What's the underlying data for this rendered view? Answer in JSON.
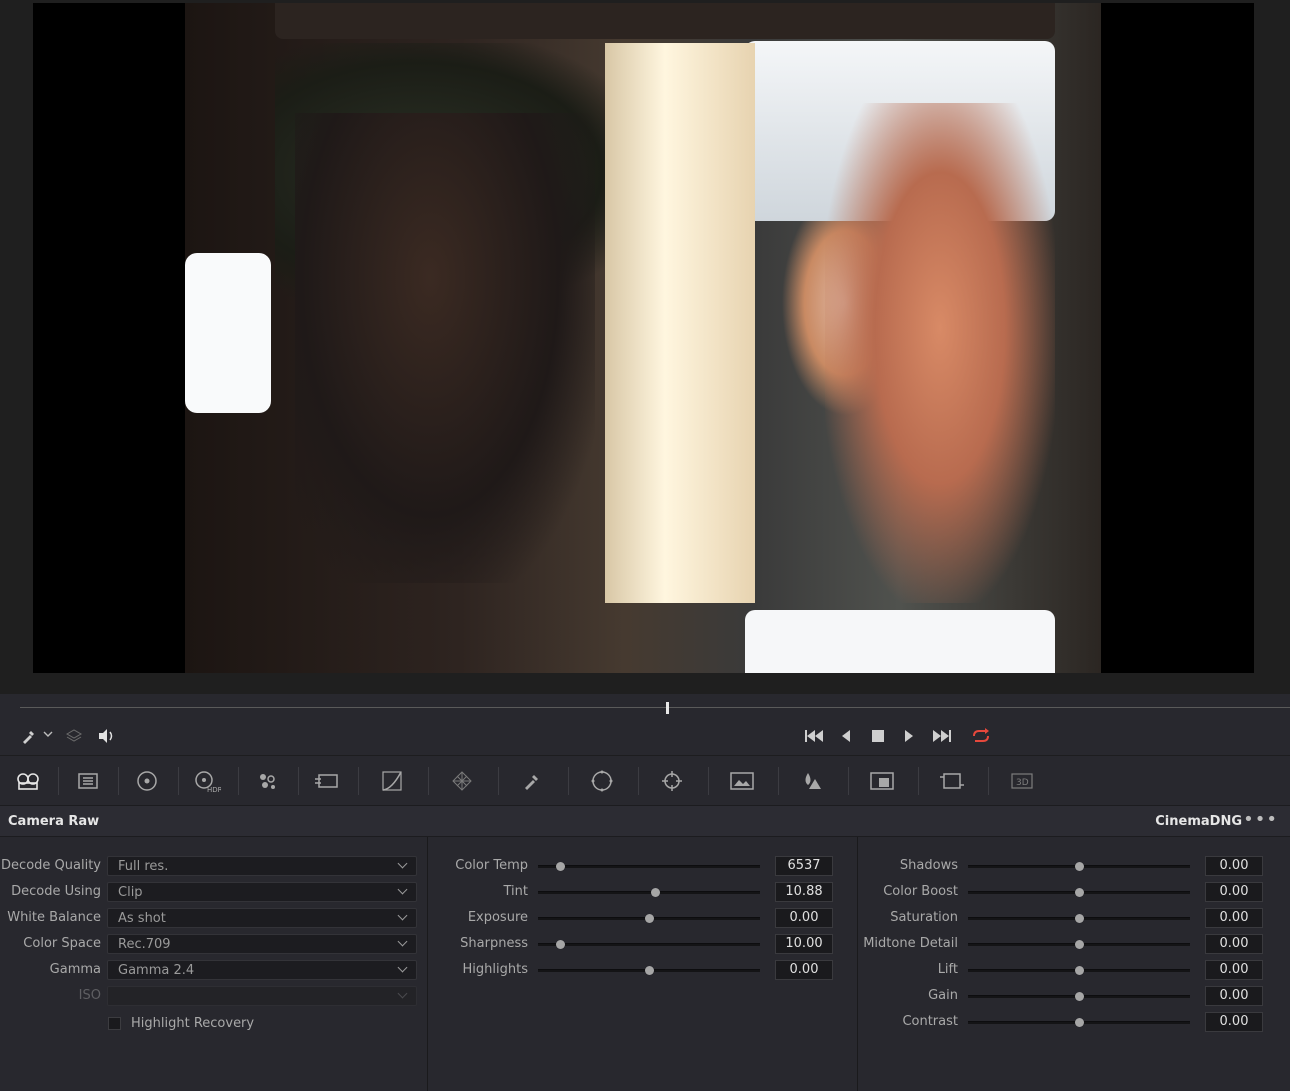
{
  "toolbar_row": {
    "tools": [
      {
        "name": "camera-raw-icon",
        "glyph": "🎞"
      },
      {
        "name": "color-match-icon",
        "glyph": "▦"
      },
      {
        "name": "color-wheels-icon",
        "glyph": "◎"
      },
      {
        "name": "hdr-wheels-icon",
        "glyph": "◐"
      },
      {
        "name": "rgb-mixer-icon",
        "glyph": "⁘"
      },
      {
        "name": "motion-effects-icon",
        "glyph": "▭"
      },
      {
        "name": "curves-icon",
        "glyph": "◿"
      },
      {
        "name": "color-warper-icon",
        "glyph": "✲"
      },
      {
        "name": "qualifier-icon",
        "glyph": "✎"
      },
      {
        "name": "window-icon",
        "glyph": "◯"
      },
      {
        "name": "tracker-icon",
        "glyph": "⊕"
      },
      {
        "name": "magic-mask-icon",
        "glyph": "▣"
      },
      {
        "name": "blur-icon",
        "glyph": "▲"
      },
      {
        "name": "key-icon",
        "glyph": "◧"
      },
      {
        "name": "sizing-icon",
        "glyph": "⟳"
      },
      {
        "name": "stereo-3d-icon",
        "glyph": "3D"
      }
    ]
  },
  "panel": {
    "title": "Camera Raw",
    "format": "CinemaDNG",
    "more": "•••"
  },
  "decode": {
    "rows": [
      {
        "label": "Decode Quality",
        "value": "Full res."
      },
      {
        "label": "Decode Using",
        "value": "Clip"
      },
      {
        "label": "White Balance",
        "value": "As shot"
      },
      {
        "label": "Color Space",
        "value": "Rec.709"
      },
      {
        "label": "Gamma",
        "value": "Gamma 2.4"
      },
      {
        "label": "ISO",
        "value": ""
      }
    ],
    "highlight_recovery": "Highlight Recovery"
  },
  "sliders_mid": [
    {
      "label": "Color Temp",
      "value": "6537",
      "pos": 0.1
    },
    {
      "label": "Tint",
      "value": "10.88",
      "pos": 0.53
    },
    {
      "label": "Exposure",
      "value": "0.00",
      "pos": 0.5
    },
    {
      "label": "Sharpness",
      "value": "10.00",
      "pos": 0.1
    },
    {
      "label": "Highlights",
      "value": "0.00",
      "pos": 0.5
    }
  ],
  "sliders_right": [
    {
      "label": "Shadows",
      "value": "0.00",
      "pos": 0.5
    },
    {
      "label": "Color Boost",
      "value": "0.00",
      "pos": 0.5
    },
    {
      "label": "Saturation",
      "value": "0.00",
      "pos": 0.5
    },
    {
      "label": "Midtone Detail",
      "value": "0.00",
      "pos": 0.5
    },
    {
      "label": "Lift",
      "value": "0.00",
      "pos": 0.5
    },
    {
      "label": "Gain",
      "value": "0.00",
      "pos": 0.5
    },
    {
      "label": "Contrast",
      "value": "0.00",
      "pos": 0.5
    }
  ]
}
